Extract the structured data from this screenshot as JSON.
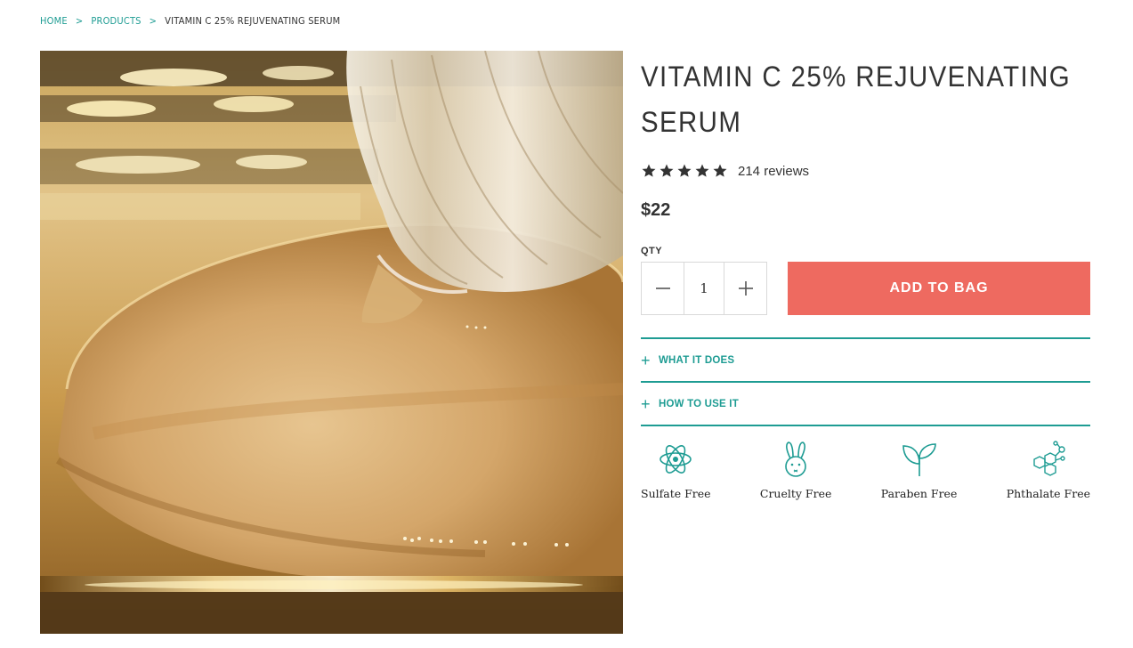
{
  "breadcrumb": {
    "home": "HOME",
    "products": "PRODUCTS",
    "current": "VITAMIN C 25% REJUVENATING SERUM",
    "separator": ">"
  },
  "product": {
    "title": "VITAMIN C 25% REJUVENATING SERUM",
    "rating": 5,
    "reviews": "214 reviews",
    "price": "$22"
  },
  "purchase": {
    "qty_label": "QTY",
    "qty_value": "1",
    "add_button": "ADD TO BAG"
  },
  "accordion": [
    {
      "label": "WHAT IT DOES"
    },
    {
      "label": "HOW TO USE IT"
    }
  ],
  "badges": [
    {
      "label": "Sulfate Free",
      "icon": "atom-icon"
    },
    {
      "label": "Cruelty Free",
      "icon": "bunny-icon"
    },
    {
      "label": "Paraben Free",
      "icon": "sprout-icon"
    },
    {
      "label": "Phthalate Free",
      "icon": "molecule-icon"
    }
  ],
  "colors": {
    "accent": "#1e9c93",
    "button": "#ee6a60",
    "text": "#333333"
  }
}
